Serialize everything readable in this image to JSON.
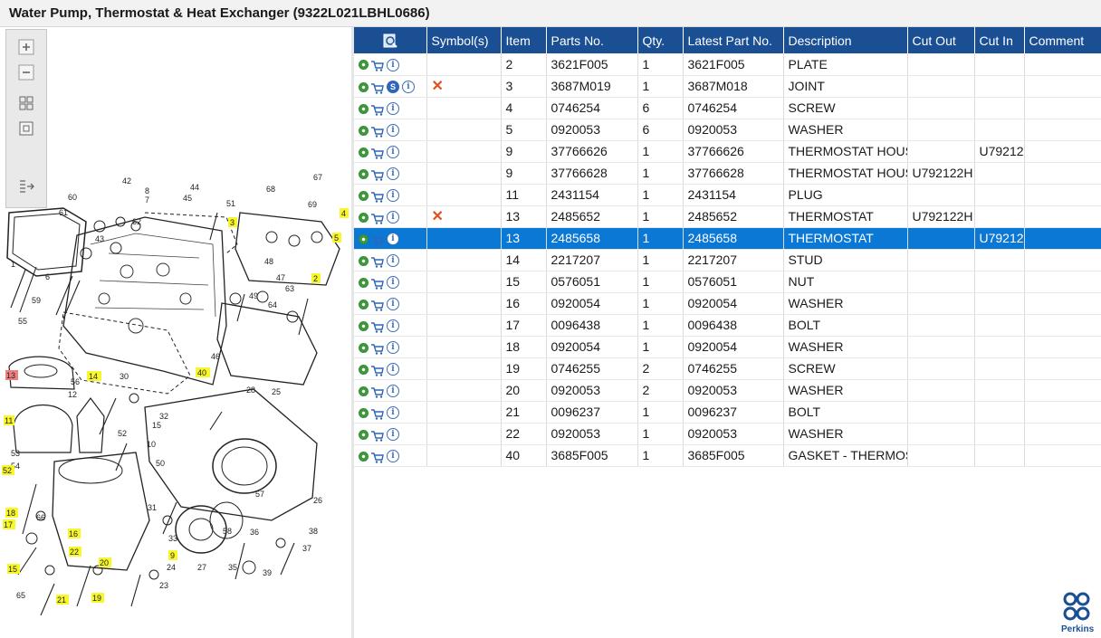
{
  "window": {
    "title": "Water Pump, Thermostat & Heat Exchanger (9322L021LBHL0686)"
  },
  "toolbar": {
    "zoom_in_icon": "zoom-in-icon",
    "zoom_out_icon": "zoom-out-icon",
    "fit_icon": "fit-icon",
    "actual_size_icon": "actual-size-icon",
    "collapse_icon": "collapse-panel-icon"
  },
  "diagram": {
    "callouts_plain": [
      "42",
      "8",
      "7",
      "60",
      "61",
      "43",
      "6",
      "59",
      "1",
      "44",
      "45",
      "51",
      "68",
      "67",
      "69",
      "62",
      "48",
      "47",
      "63",
      "64",
      "49",
      "50",
      "55",
      "56",
      "46",
      "30",
      "12",
      "53",
      "54",
      "32",
      "10",
      "15",
      "31",
      "28",
      "25",
      "36",
      "57",
      "26",
      "27",
      "58",
      "35",
      "39",
      "37",
      "38",
      "33",
      "24",
      "23",
      "65",
      "66"
    ],
    "callouts_highlight": [
      "3",
      "4",
      "5",
      "2",
      "40",
      "14",
      "11",
      "52",
      "18",
      "17",
      "16",
      "22",
      "20",
      "9",
      "21",
      "19",
      "15"
    ],
    "callouts_red": [
      "13"
    ]
  },
  "table": {
    "search_icon": "search-icon",
    "columns": [
      "",
      "Symbol(s)",
      "Item",
      "Parts No.",
      "Qty.",
      "Latest Part No.",
      "Description",
      "Cut Out",
      "Cut In",
      "Comment"
    ],
    "rows": [
      {
        "icons": [
          "gear",
          "cart",
          "info"
        ],
        "symbol": "",
        "item": "2",
        "part_no": "3621F005",
        "qty": "1",
        "latest": "3621F005",
        "desc": "PLATE",
        "cut_out": "",
        "cut_in": "",
        "comment": ""
      },
      {
        "icons": [
          "gear",
          "cart",
          "s",
          "info"
        ],
        "symbol": "✕",
        "item": "3",
        "part_no": "3687M019",
        "qty": "1",
        "latest": "3687M018",
        "desc": "JOINT",
        "cut_out": "",
        "cut_in": "",
        "comment": ""
      },
      {
        "icons": [
          "gear",
          "cart",
          "info"
        ],
        "symbol": "",
        "item": "4",
        "part_no": "0746254",
        "qty": "6",
        "latest": "0746254",
        "desc": "SCREW",
        "cut_out": "",
        "cut_in": "",
        "comment": ""
      },
      {
        "icons": [
          "gear",
          "cart",
          "info"
        ],
        "symbol": "",
        "item": "5",
        "part_no": "0920053",
        "qty": "6",
        "latest": "0920053",
        "desc": "WASHER",
        "cut_out": "",
        "cut_in": "",
        "comment": ""
      },
      {
        "icons": [
          "gear",
          "cart",
          "info"
        ],
        "symbol": "",
        "item": "9",
        "part_no": "37766626",
        "qty": "1",
        "latest": "37766626",
        "desc": "THERMOSTAT HOUS",
        "cut_out": "",
        "cut_in": "U79212",
        "comment": ""
      },
      {
        "icons": [
          "gear",
          "cart",
          "info"
        ],
        "symbol": "",
        "item": "9",
        "part_no": "37766628",
        "qty": "1",
        "latest": "37766628",
        "desc": "THERMOSTAT HOUS",
        "cut_out": "U792122H",
        "cut_in": "",
        "comment": ""
      },
      {
        "icons": [
          "gear",
          "cart",
          "info"
        ],
        "symbol": "",
        "item": "11",
        "part_no": "2431154",
        "qty": "1",
        "latest": "2431154",
        "desc": "PLUG",
        "cut_out": "",
        "cut_in": "",
        "comment": ""
      },
      {
        "icons": [
          "gear",
          "cart",
          "info"
        ],
        "symbol": "✕",
        "item": "13",
        "part_no": "2485652",
        "qty": "1",
        "latest": "2485652",
        "desc": "THERMOSTAT",
        "cut_out": "U792122H",
        "cut_in": "",
        "comment": ""
      },
      {
        "icons": [
          "gear",
          "cart",
          "info"
        ],
        "symbol": "",
        "item": "13",
        "part_no": "2485658",
        "qty": "1",
        "latest": "2485658",
        "desc": "THERMOSTAT",
        "cut_out": "",
        "cut_in": "U79212",
        "comment": "",
        "selected": true
      },
      {
        "icons": [
          "gear",
          "cart",
          "info"
        ],
        "symbol": "",
        "item": "14",
        "part_no": "2217207",
        "qty": "1",
        "latest": "2217207",
        "desc": "STUD",
        "cut_out": "",
        "cut_in": "",
        "comment": ""
      },
      {
        "icons": [
          "gear",
          "cart",
          "info"
        ],
        "symbol": "",
        "item": "15",
        "part_no": "0576051",
        "qty": "1",
        "latest": "0576051",
        "desc": "NUT",
        "cut_out": "",
        "cut_in": "",
        "comment": ""
      },
      {
        "icons": [
          "gear",
          "cart",
          "info"
        ],
        "symbol": "",
        "item": "16",
        "part_no": "0920054",
        "qty": "1",
        "latest": "0920054",
        "desc": "WASHER",
        "cut_out": "",
        "cut_in": "",
        "comment": ""
      },
      {
        "icons": [
          "gear",
          "cart",
          "info"
        ],
        "symbol": "",
        "item": "17",
        "part_no": "0096438",
        "qty": "1",
        "latest": "0096438",
        "desc": "BOLT",
        "cut_out": "",
        "cut_in": "",
        "comment": ""
      },
      {
        "icons": [
          "gear",
          "cart",
          "info"
        ],
        "symbol": "",
        "item": "18",
        "part_no": "0920054",
        "qty": "1",
        "latest": "0920054",
        "desc": "WASHER",
        "cut_out": "",
        "cut_in": "",
        "comment": ""
      },
      {
        "icons": [
          "gear",
          "cart",
          "info"
        ],
        "symbol": "",
        "item": "19",
        "part_no": "0746255",
        "qty": "2",
        "latest": "0746255",
        "desc": "SCREW",
        "cut_out": "",
        "cut_in": "",
        "comment": ""
      },
      {
        "icons": [
          "gear",
          "cart",
          "info"
        ],
        "symbol": "",
        "item": "20",
        "part_no": "0920053",
        "qty": "2",
        "latest": "0920053",
        "desc": "WASHER",
        "cut_out": "",
        "cut_in": "",
        "comment": ""
      },
      {
        "icons": [
          "gear",
          "cart",
          "info"
        ],
        "symbol": "",
        "item": "21",
        "part_no": "0096237",
        "qty": "1",
        "latest": "0096237",
        "desc": "BOLT",
        "cut_out": "",
        "cut_in": "",
        "comment": ""
      },
      {
        "icons": [
          "gear",
          "cart",
          "info"
        ],
        "symbol": "",
        "item": "22",
        "part_no": "0920053",
        "qty": "1",
        "latest": "0920053",
        "desc": "WASHER",
        "cut_out": "",
        "cut_in": "",
        "comment": ""
      },
      {
        "icons": [
          "gear",
          "cart",
          "info"
        ],
        "symbol": "",
        "item": "40",
        "part_no": "3685F005",
        "qty": "1",
        "latest": "3685F005",
        "desc": "GASKET - THERMOS",
        "cut_out": "",
        "cut_in": "",
        "comment": ""
      }
    ]
  },
  "branding": {
    "logo_text": "Perkins",
    "color": "#1b4f94"
  },
  "colors": {
    "header_bg": "#1b4f94",
    "selected_row": "#0a78d4",
    "callout_highlight": "#f7f72a",
    "callout_red": "#f08080"
  }
}
